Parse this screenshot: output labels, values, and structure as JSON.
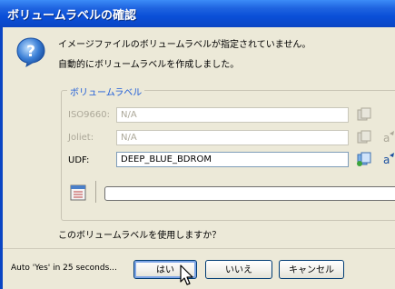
{
  "window": {
    "title": "ボリュームラベルの確認"
  },
  "messages": {
    "line1": "イメージファイルのボリュームラベルが指定されていません。",
    "line2": "自動的にボリュームラベルを作成しました。",
    "question": "このボリュームラベルを使用しますか？"
  },
  "volume_group": {
    "label": "ボリュームラベル",
    "rows": [
      {
        "label": "ISO9660:",
        "value": "N/A",
        "enabled": false
      },
      {
        "label": "Joliet:",
        "value": "N/A",
        "enabled": false
      },
      {
        "label": "UDF:",
        "value": "DEEP_BLUE_BDROM",
        "enabled": true
      }
    ]
  },
  "progress": {
    "value": 0
  },
  "footer": {
    "auto_text": "Auto 'Yes' in 25 seconds...",
    "buttons": {
      "yes": "はい",
      "no": "いいえ",
      "cancel": "キャンセル"
    }
  },
  "colors": {
    "titlebar": "#0a4fd8",
    "group_label": "#1d5cd8",
    "dialog_bg": "#ece9d8"
  },
  "icons": {
    "question": "question-icon",
    "copy": "copy-icon",
    "checklist": "checklist-icon"
  }
}
